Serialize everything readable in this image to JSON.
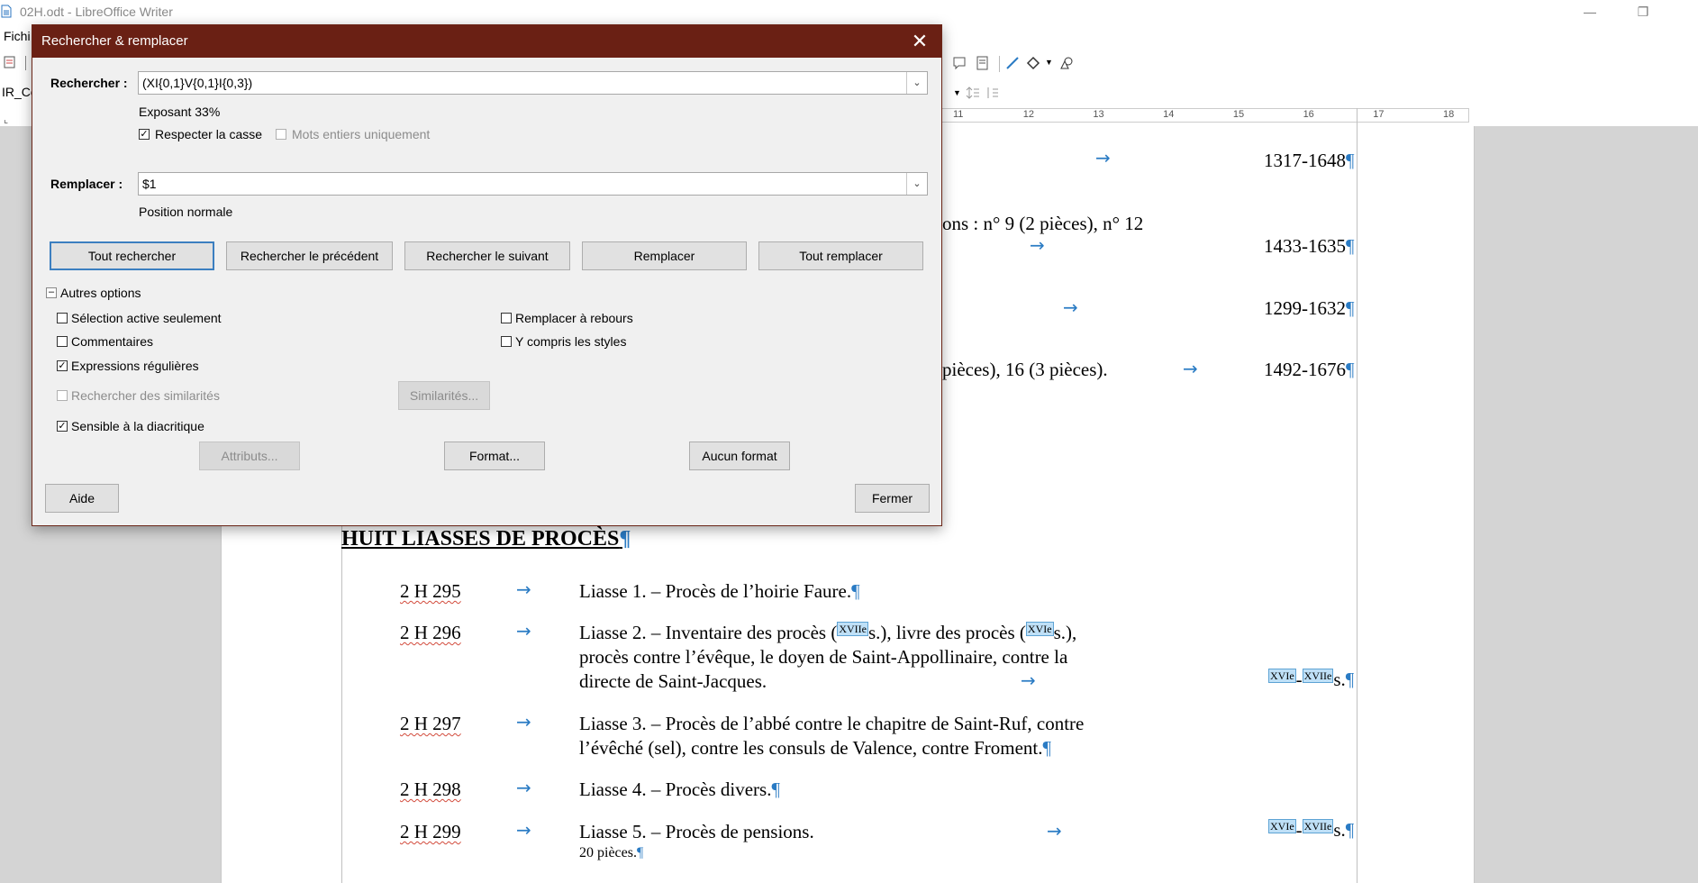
{
  "window": {
    "title": "02H.odt - LibreOffice Writer",
    "minimize_icon": "minimize-icon",
    "restore_icon": "restore-icon"
  },
  "menubar": {
    "first_item": "Fichi"
  },
  "toolbar2": {
    "style_box": "IR_Co"
  },
  "dialog": {
    "title": "Rechercher & remplacer",
    "find_label": "Rechercher :",
    "find_value": "(XI{0,1}V{0,1}I{0,3})",
    "find_format": "Exposant 33%",
    "match_case_label": "Respecter la casse",
    "match_case_checked": true,
    "whole_words_label": "Mots entiers uniquement",
    "whole_words_checked": false,
    "replace_label": "Remplacer :",
    "replace_value": "$1",
    "replace_format": "Position normale",
    "buttons": {
      "find_all": "Tout rechercher",
      "find_prev": "Rechercher le précédent",
      "find_next": "Rechercher le suivant",
      "replace": "Remplacer",
      "replace_all": "Tout remplacer"
    },
    "other_options": "Autres options",
    "options": {
      "current_selection": "Sélection active seulement",
      "comments": "Commentaires",
      "regex": "Expressions régulières",
      "similarity": "Rechercher des similarités",
      "similarity_btn": "Similarités...",
      "diacritics": "Sensible à la diacritique",
      "replace_backwards": "Remplacer à rebours",
      "including_styles": "Y compris les styles"
    },
    "checked": {
      "current_selection": false,
      "comments": false,
      "regex": true,
      "similarity": false,
      "diacritics": true,
      "replace_backwards": false,
      "including_styles": false
    },
    "attributes_btn": "Attributs...",
    "format_btn": "Format...",
    "no_format_btn": "Aucun format",
    "help_btn": "Aide",
    "close_btn": "Fermer"
  },
  "document": {
    "ruler_marks": [
      "11",
      "12",
      "13",
      "14",
      "15",
      "16",
      "17",
      "18"
    ],
    "rows_above": [
      {
        "text": "",
        "date": "1317-1648"
      },
      {
        "text": "ons : n° 9 (2 pièces), n° 12",
        "date": "1433-1635"
      },
      {
        "text": "",
        "date": "1299-1632"
      },
      {
        "text": "pièces), 16 (3 pièces).",
        "date": "1492-1676"
      }
    ],
    "heading": "HUIT LIASSES DE PROCÈS",
    "entries": [
      {
        "ref": "2 H 295",
        "lines": [
          "Liasse 1. – Procès de l’hoirie Faure."
        ]
      },
      {
        "ref": "2 H 296",
        "lines": [
          "Liasse 2. – Inventaire des procès (",
          "s.), livre des procès (",
          "s.),",
          "procès contre l’évêque, le doyen de Saint-Appollinaire, contre la",
          "directe de Saint-Jacques."
        ]
      },
      {
        "ref": "2 H 297",
        "lines": [
          "Liasse 3. – Procès de l’abbé contre le chapitre de Saint-Ruf, contre",
          "l’évêché (sel), contre les consuls de Valence, contre Froment."
        ]
      },
      {
        "ref": "2 H 298",
        "lines": [
          "Liasse 4. – Procès divers."
        ]
      },
      {
        "ref": "2 H 299",
        "lines": [
          "Liasse 5. – Procès de pensions.",
          "20 pièces."
        ]
      }
    ],
    "sup_xvii": "XVIIe",
    "sup_xvi": "XVIe",
    "century_suffix": "s.",
    "dash": "-",
    "pilcrow": "¶",
    "arrow": "→"
  }
}
